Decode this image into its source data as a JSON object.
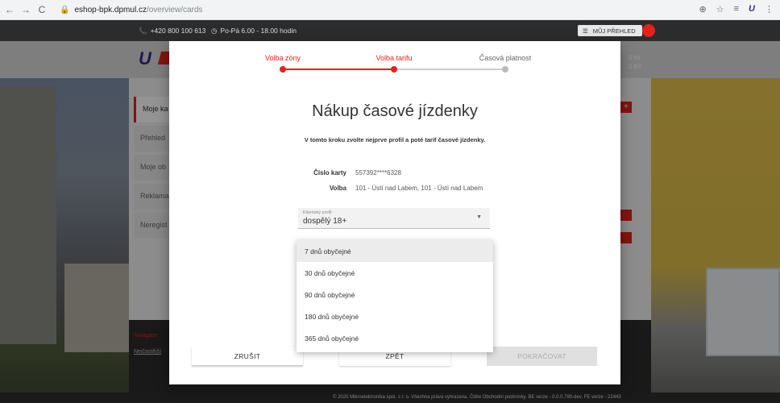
{
  "browser": {
    "back_icon": "arrow-left-icon",
    "forward_icon": "arrow-right-icon",
    "reload_icon": "reload-icon",
    "url_host": "eshop-bpk.dpmul.cz",
    "url_path": "/overview/cards",
    "right_icons": [
      "zoom-icon",
      "star-icon",
      "reading-list-icon",
      "extension-icon",
      "menu-icon"
    ]
  },
  "topbar": {
    "phone": "+420 800 100 613",
    "hours": "Po-Pá 6.00 - 18.00 hodin",
    "my_overview": "MŮJ PŘEHLED"
  },
  "header": {
    "cart_count": "0 ks",
    "cart_price": "0 Kč"
  },
  "side_menu": {
    "items": [
      "Moje ka",
      "Přehled",
      "Moje ob",
      "Reklama",
      "Neregist"
    ]
  },
  "footer": {
    "nav_label": "Navigace",
    "faq_label": "Nejčastější",
    "copyright": "© 2020 Mikroelektronika spol. s r. o. Všechna práva vyhrazena. Čtěte Obchodní podmínky. BE verze - 0.0.0.790-dev, FE verze - 22443"
  },
  "modal": {
    "steps": [
      {
        "label": "Volba zóny",
        "state": "done"
      },
      {
        "label": "Volba tarifu",
        "state": "active"
      },
      {
        "label": "Časová platnost",
        "state": "pending"
      }
    ],
    "title": "Nákup časové jízdenky",
    "subtitle": "V tomto kroku zvolte nejprve profil a poté tarif časové jízdenky.",
    "card_label": "Číslo karty",
    "card_value": "557392****6328",
    "zone_label": "Volba",
    "zone_value": "101 - Ústí nad Labem, 101 - Ústí nad Labem",
    "profile_label": "Klientský profil",
    "profile_value": "dospělý 18+",
    "tariff_options": [
      "7 dnů obyčejné",
      "30 dnů obyčejné",
      "90 dnů obyčejné",
      "180 dnů obyčejné",
      "365 dnů obyčejné"
    ],
    "cancel_label": "ZRUŠIT",
    "back_label": "ZPĚT",
    "next_label": "POKRAČOVAT"
  },
  "colors": {
    "accent": "#e2231a",
    "brand": "#3b2a8c"
  }
}
